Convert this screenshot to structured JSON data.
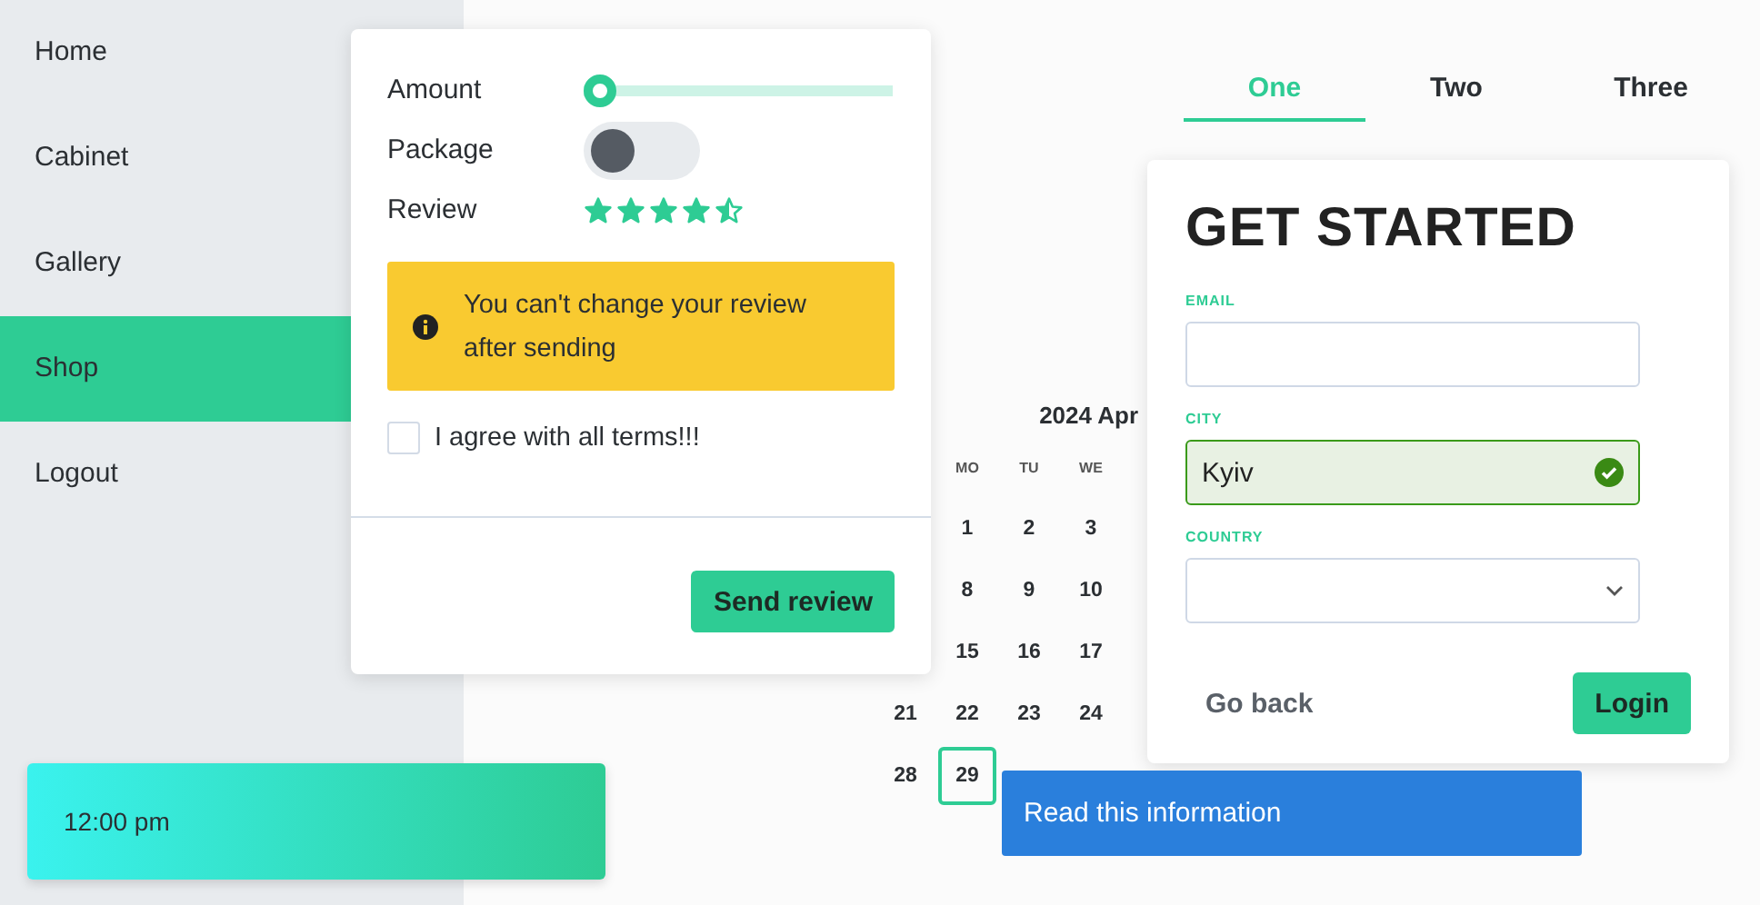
{
  "sidebar": {
    "items": [
      {
        "label": "Home",
        "selected": false
      },
      {
        "label": "Cabinet",
        "selected": false
      },
      {
        "label": "Gallery",
        "selected": false
      },
      {
        "label": "Shop",
        "selected": true
      },
      {
        "label": "Logout",
        "selected": false
      }
    ]
  },
  "clock": {
    "time": "12:00 pm"
  },
  "review_card": {
    "amount": {
      "label": "Amount",
      "level": 0
    },
    "package": {
      "label": "Package",
      "on": false
    },
    "review": {
      "label": "Review",
      "stars": 4.5
    },
    "alert": {
      "text": "You can't change your review after sending"
    },
    "terms": {
      "label": "I agree with all terms!!!",
      "checked": false
    },
    "submit": "Send review"
  },
  "calendar": {
    "title": "2024 Apr",
    "weekdays": [
      "MO",
      "TU",
      "WE"
    ],
    "weeks": [
      [
        {
          "day": "1",
          "selected": false
        },
        {
          "day": "2",
          "selected": false
        },
        {
          "day": "3",
          "selected": false
        }
      ],
      [
        {
          "day": "8",
          "selected": false
        },
        {
          "day": "9",
          "selected": false
        },
        {
          "day": "10",
          "selected": false
        }
      ],
      [
        {
          "day": "15",
          "selected": false
        },
        {
          "day": "16",
          "selected": false
        },
        {
          "day": "17",
          "selected": false
        }
      ],
      [
        {
          "day": "21",
          "selected": false
        },
        {
          "day": "22",
          "selected": false
        },
        {
          "day": "23",
          "selected": false
        },
        {
          "day": "24",
          "selected": false
        }
      ],
      [
        {
          "day": "28",
          "selected": false
        },
        {
          "day": "29",
          "selected": true
        }
      ]
    ]
  },
  "tabs": [
    {
      "label": "One",
      "selected": true
    },
    {
      "label": "Two",
      "selected": false
    },
    {
      "label": "Three",
      "selected": false
    }
  ],
  "login": {
    "title": "GET STARTED",
    "fields": [
      {
        "kind": "text",
        "label": "EMAIL",
        "valid": false
      },
      {
        "kind": "text",
        "label": "CITY",
        "value": "Kyiv",
        "valid": true
      },
      {
        "kind": "select",
        "label": "COUNTRY",
        "valid": false
      }
    ],
    "back": "Go back",
    "submit": "Login"
  },
  "banner": {
    "text": "Read this information"
  }
}
